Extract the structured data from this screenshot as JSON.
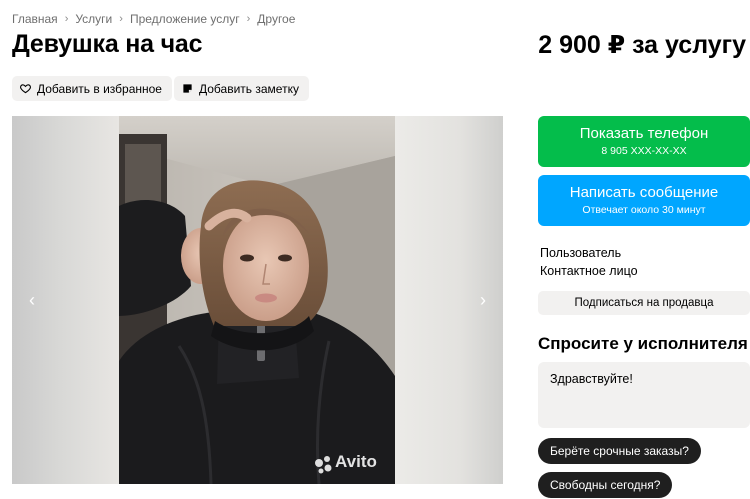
{
  "breadcrumb": [
    "Главная",
    "Услуги",
    "Предложение услуг",
    "Другое"
  ],
  "listing": {
    "title": "Девушка на час",
    "price": "2 900 ₽ за услугу"
  },
  "actions": {
    "favorite_label": "Добавить в избранное",
    "note_label": "Добавить заметку"
  },
  "gallery": {
    "watermark": "Avito",
    "prev_icon": "chevron-left-icon",
    "next_icon": "chevron-right-icon"
  },
  "contact": {
    "phone_label": "Показать телефон",
    "phone_masked": "8 905 XXX-XX-XX",
    "message_label": "Написать сообщение",
    "message_sub": "Отвечает около 30 минут"
  },
  "seller": {
    "type": "Пользователь",
    "role": "Контактное лицо",
    "subscribe_label": "Подписаться на продавца"
  },
  "ask": {
    "title": "Спросите у исполнителя",
    "message_value": "Здравствуйте!",
    "quick_replies": [
      "Берёте срочные заказы?",
      "Свободны сегодня?"
    ]
  },
  "colors": {
    "phone_button": "#04bd4b",
    "message_button": "#00a6ff",
    "chip_bg": "#f2f1f0",
    "pill_bg": "#1f1f1f"
  }
}
